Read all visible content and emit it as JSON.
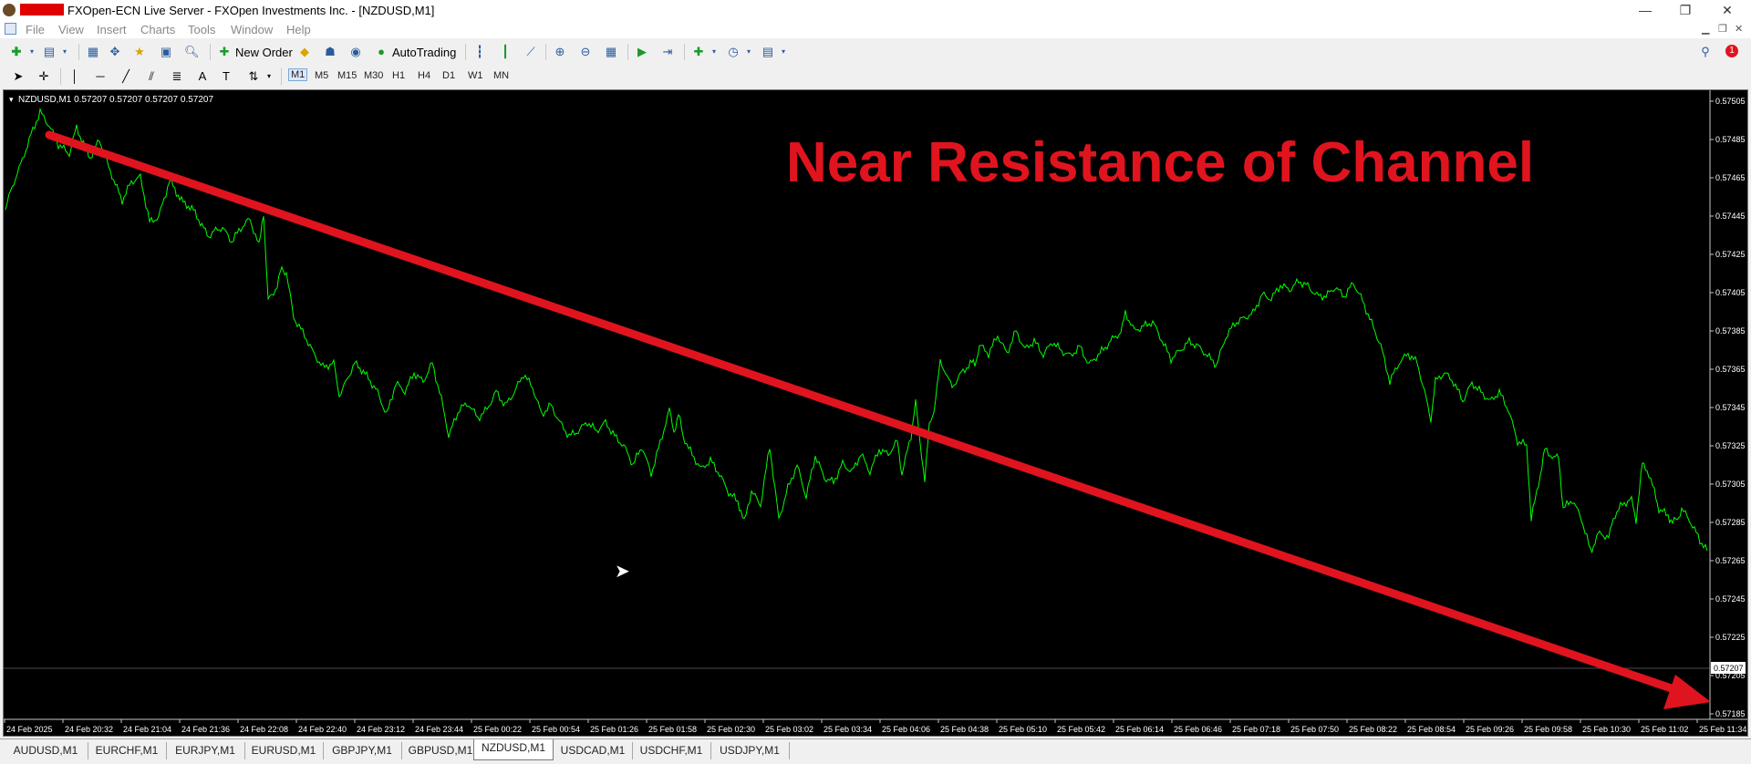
{
  "window": {
    "title": "FXOpen-ECN Live Server - FXOpen Investments Inc. - [NZDUSD,M1]",
    "controls": [
      "—",
      "❐",
      "✕"
    ]
  },
  "menu": [
    "File",
    "View",
    "Insert",
    "Charts",
    "Tools",
    "Window",
    "Help"
  ],
  "toolbar": {
    "new_order": "New Order",
    "auto_trading": "AutoTrading",
    "alerts_badge": "1"
  },
  "timeframes": [
    "M1",
    "M5",
    "M15",
    "M30",
    "H1",
    "H4",
    "D1",
    "W1",
    "MN"
  ],
  "active_timeframe": "M1",
  "chart": {
    "header": "NZDUSD,M1  0.57207 0.57207 0.57207 0.57207",
    "annotation": "Near Resistance of Channel",
    "current_price": "0.57207",
    "price_labels": [
      "0.57505",
      "0.57485",
      "0.57465",
      "0.57445",
      "0.57425",
      "0.57405",
      "0.57385",
      "0.57365",
      "0.57345",
      "0.57325",
      "0.57305",
      "0.57285",
      "0.57265",
      "0.57245",
      "0.57225",
      "0.57205",
      "0.57185"
    ],
    "time_labels": [
      "24 Feb 2025",
      "24 Feb 20:32",
      "24 Feb 21:04",
      "24 Feb 21:36",
      "24 Feb 22:08",
      "24 Feb 22:40",
      "24 Feb 23:12",
      "24 Feb 23:44",
      "25 Feb 00:22",
      "25 Feb 00:54",
      "25 Feb 01:26",
      "25 Feb 01:58",
      "25 Feb 02:30",
      "25 Feb 03:02",
      "25 Feb 03:34",
      "25 Feb 04:06",
      "25 Feb 04:38",
      "25 Feb 05:10",
      "25 Feb 05:42",
      "25 Feb 06:14",
      "25 Feb 06:46",
      "25 Feb 07:18",
      "25 Feb 07:50",
      "25 Feb 08:22",
      "25 Feb 08:54",
      "25 Feb 09:26",
      "25 Feb 09:58",
      "25 Feb 10:30",
      "25 Feb 11:02",
      "25 Feb 11:34"
    ],
    "colors": {
      "price_line": "#00ff00",
      "arrow": "#e0141e",
      "text": "#e0141e"
    }
  },
  "tabs": [
    "AUDUSD,M1",
    "EURCHF,M1",
    "EURJPY,M1",
    "EURUSD,M1",
    "GBPJPY,M1",
    "GBPUSD,M1",
    "NZDUSD,M1",
    "USDCAD,M1",
    "USDCHF,M1",
    "USDJPY,M1"
  ],
  "active_tab": "NZDUSD,M1"
}
